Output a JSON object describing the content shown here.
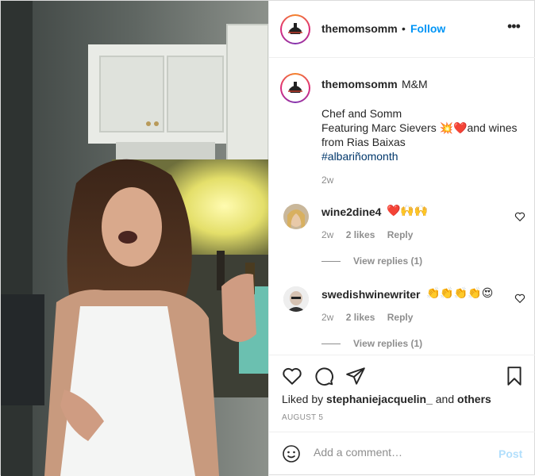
{
  "header": {
    "username": "themomsomm",
    "separator": "•",
    "follow_label": "Follow",
    "more_label": "•••"
  },
  "caption": {
    "username": "themomsomm",
    "title": "M&M",
    "line1": "Chef and Somm",
    "line2": "Featuring Marc Sievers 💥❤️and wines",
    "line3": "from Rias Baixas",
    "hashtag": "#albariñomonth",
    "time": "2w"
  },
  "comments": [
    {
      "username": "wine2dine4",
      "text": "❤️🙌🙌",
      "time": "2w",
      "likes": "2 likes",
      "reply_label": "Reply",
      "view_replies": "View replies (1)"
    },
    {
      "username": "swedishwinewriter",
      "text": "👏👏👏👏😍",
      "time": "2w",
      "likes": "2 likes",
      "reply_label": "Reply",
      "view_replies": "View replies (1)"
    }
  ],
  "liked": {
    "prefix": "Liked by ",
    "user": "stephaniejacquelin_",
    "middle": " and ",
    "others": "others"
  },
  "date": "AUGUST 5",
  "add_comment": {
    "placeholder": "Add a comment…",
    "post_label": "Post"
  },
  "colors": {
    "follow": "#0095f6",
    "post_disabled": "#b2dffc",
    "hashtag": "#00376b",
    "secondary_text": "#8e8e8e"
  },
  "icons": [
    "like-icon",
    "comment-icon",
    "share-icon",
    "save-icon",
    "emoji-icon",
    "heart-icon",
    "more-icon"
  ]
}
